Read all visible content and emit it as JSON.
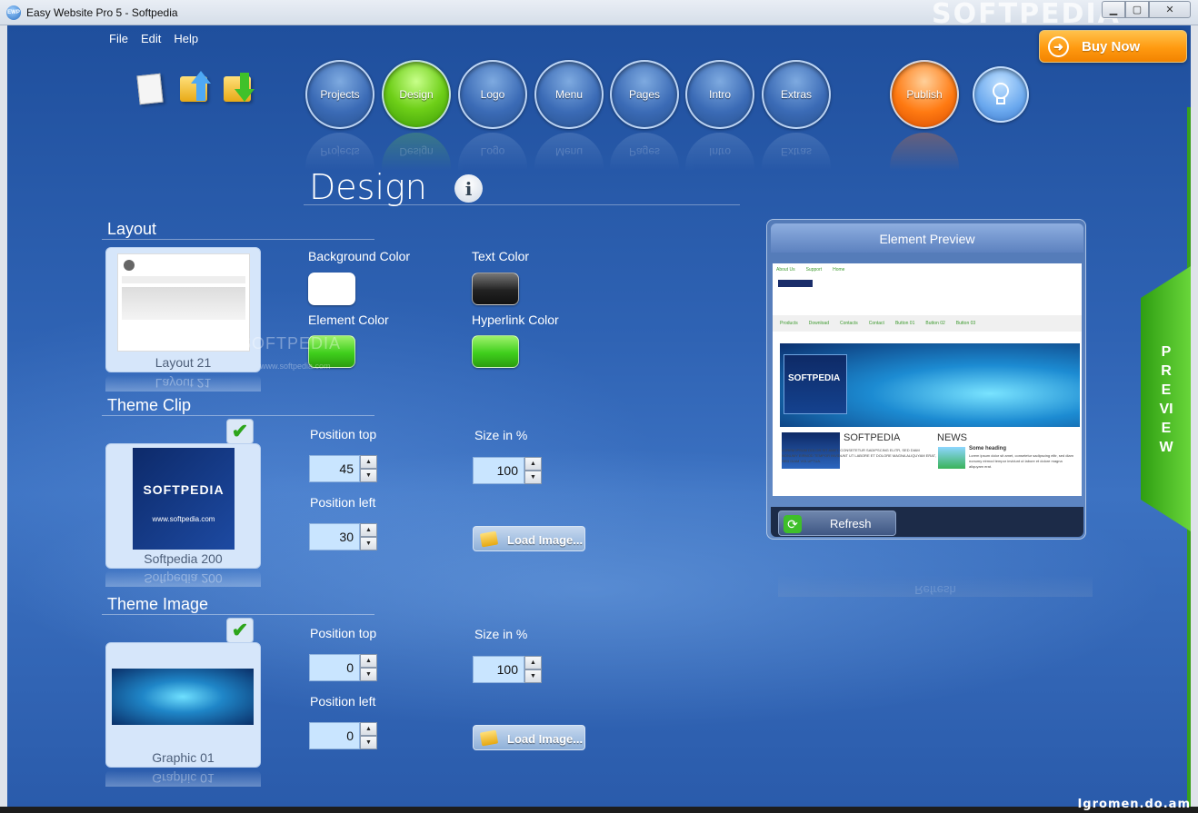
{
  "window": {
    "title": "Easy Website Pro 5 - Softpedia",
    "watermark": "SOFTPEDIA",
    "icon": "app-icon",
    "app_icon_text": "EWP",
    "controls": [
      "minimize-icon",
      "maximize-icon",
      "close-icon"
    ]
  },
  "menubar": {
    "items": [
      "File",
      "Edit",
      "Help"
    ]
  },
  "toolbar": {
    "icons": [
      "new-document-icon",
      "open-folder-icon",
      "save-folder-icon"
    ]
  },
  "nav": {
    "items": [
      "Projects",
      "Design",
      "Logo",
      "Menu",
      "Pages",
      "Intro",
      "Extras"
    ],
    "active": "Design",
    "publish": "Publish",
    "tip_icon": "lightbulb-icon"
  },
  "buy_now": {
    "label": "Buy Now",
    "icon": "arrow-right-icon"
  },
  "page": {
    "title": "Design",
    "info_icon": "info-icon"
  },
  "layout": {
    "label": "Layout",
    "thumb_caption": "Layout 21",
    "background_color_label": "Background Color",
    "text_color_label": "Text Color",
    "element_color_label": "Element Color",
    "hyperlink_color_label": "Hyperlink Color",
    "colors": {
      "background": "#ffffff",
      "text": "#2a2a2a",
      "element": "#3fcf1c",
      "hyperlink": "#3fcf1c"
    }
  },
  "theme_clip": {
    "label": "Theme Clip",
    "checked": true,
    "thumb_caption": "Softpedia 200",
    "thumb_title": "SOFTPEDIA",
    "thumb_sub": "www.softpedia.com",
    "position_top_label": "Position top",
    "position_top": "45",
    "position_left_label": "Position left",
    "position_left": "30",
    "size_label": "Size in %",
    "size": "100",
    "load_label": "Load Image..."
  },
  "theme_image": {
    "label": "Theme Image",
    "checked": true,
    "thumb_caption": "Graphic 01",
    "position_top_label": "Position top",
    "position_top": "0",
    "position_left_label": "Position left",
    "position_left": "0",
    "size_label": "Size in %",
    "size": "100",
    "load_label": "Load Image..."
  },
  "watermark": {
    "text": "SOFTPEDIA",
    "url": "www.softpedia.com"
  },
  "preview": {
    "header": "Element Preview",
    "refresh_label": "Refresh",
    "tab_label": "PREVIEW",
    "site": {
      "topnav": [
        "About Us",
        "Support",
        "Home"
      ],
      "menu": [
        "Products",
        "Download",
        "Contacts",
        "Contact",
        "Button 01",
        "Button 02",
        "Button 03"
      ],
      "banner_title": "SOFTPEDIA",
      "heading_left": "SOFTPEDIA",
      "heading_right": "NEWS",
      "some_heading": "Some heading",
      "body_text": "LOREM IPSUM DOLOR SIT AMET, CONSETETUR SADIPSCING ELITR, SED DIAM NONUMY EIRMOD TEMPOR INVIDUNT UT LABORE ET DOLORE MAGNA ALIQUYAM ERAT, SED DIAM VOLUPTUA.",
      "news_text": "Lorem ipsum dolor sit amet, consetetur sadipscing elitr, sed diam nonumy eirmod tempor invidunt ut labore et dolore magna aliquyam erat."
    }
  },
  "footer_watermark": "Igromen.do.am"
}
